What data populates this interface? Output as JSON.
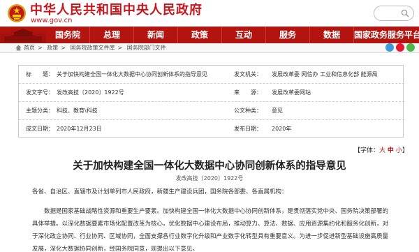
{
  "header": {
    "site_title": "中华人民共和国中央人民政府",
    "site_url": "www.gov.cn"
  },
  "nav": {
    "items": [
      "国务院",
      "总理",
      "新闻",
      "政策",
      "互动",
      "服务",
      "数据",
      "国家政务服务平台"
    ]
  },
  "breadcrumb": [
    "首页",
    "政策",
    "国务院政策文件库",
    "国务院部门文件"
  ],
  "info": {
    "rows": [
      {
        "label": "标　　题：",
        "value": "关于加快构建全国一体化大数据中心协同创新体系的指导意见",
        "label2": "发文机关：",
        "value2": "发展改革委  网信办  工业和信息化部  能源局"
      },
      {
        "label": "发文字号：",
        "value": "发改高技〔2020〕1922号",
        "label2": "来　　源：",
        "value2": "发展改革委网站"
      },
      {
        "label": "主题分类：",
        "value": "科技、教育\\科技",
        "label2": "公文种类：",
        "value2": "意见"
      },
      {
        "label": "成文日期：",
        "value": "2020年12月23日",
        "label2": "发布日期：",
        "value2": "2020年"
      }
    ]
  },
  "font_size": {
    "prefix": "【字体：",
    "big": "大",
    "mid": "中",
    "small": "小",
    "suffix": "】"
  },
  "article": {
    "title": "关于加快构建全国一体化大数据中心协同创新体系的指导意见",
    "doc_no": "发改高技〔2020〕1922号",
    "p1": "各省、自治区、直辖市及计划单列市人民政府，新疆生产建设兵团，国务院各部委、各直属机构：",
    "p2": "数据是国家基础战略性资源和重要生产要素。加快构建全国一体化大数据中心协同创新体系，是贯彻落实党中央、国务院决策部署的具体举措。以深化数据要素市场化配置改革为核心，优化数据中心建设布局，推动算力、算法、数据、应用资源集约化和服务化创新，对于深化政企协同、行业协同、区域协同，全面支撑各行业数字化升级和产业数字化转型具有重要意义。为进一步促进新型基础设施高质量发展，深化大数据协同创新，经国务院同意，现提出以下意见。"
  },
  "colors": {
    "brand_red": "#b4140f",
    "title_red": "#c4161c"
  }
}
